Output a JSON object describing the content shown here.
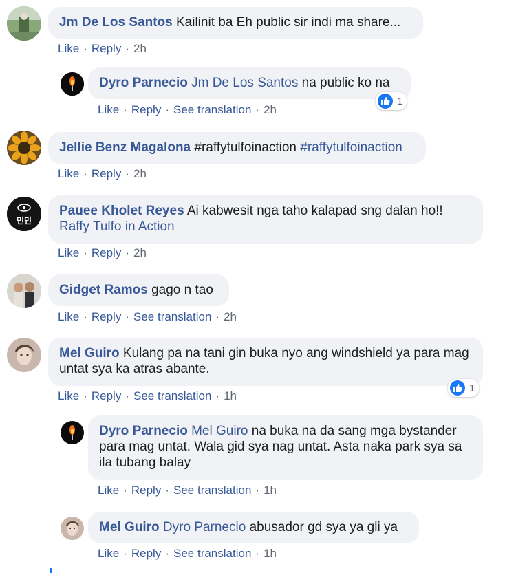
{
  "comments": [
    {
      "author": "Jm De Los Santos",
      "text": " Kailinit ba Eh public sir indi ma share...",
      "actions": {
        "like": "Like",
        "reply": "Reply",
        "time": "2h"
      }
    },
    {
      "author": "Dyro Parnecio",
      "mention": "Jm De Los Santos",
      "text": " na public ko na",
      "actions": {
        "like": "Like",
        "reply": "Reply",
        "translate": "See translation",
        "time": "2h"
      },
      "reaction_count": "1"
    },
    {
      "author": "Jellie Benz Magalona",
      "text": " #raffytulfoinaction ",
      "hashtag": "#raffytulfoinaction",
      "actions": {
        "like": "Like",
        "reply": "Reply",
        "time": "2h"
      }
    },
    {
      "author": "Pauee Kholet Reyes",
      "text": " Ai kabwesit nga taho kalapad sng dalan ho!!",
      "mention": "Raffy Tulfo in Action",
      "avatar_text": "민민",
      "actions": {
        "like": "Like",
        "reply": "Reply",
        "time": "2h"
      }
    },
    {
      "author": "Gidget Ramos",
      "text": " gago n tao",
      "actions": {
        "like": "Like",
        "reply": "Reply",
        "translate": "See translation",
        "time": "2h"
      }
    },
    {
      "author": "Mel Guiro",
      "text": " Kulang pa na tani gin buka nyo ang windshield ya para mag untat sya ka atras abante.",
      "actions": {
        "like": "Like",
        "reply": "Reply",
        "translate": "See translation",
        "time": "1h"
      },
      "reaction_count": "1"
    },
    {
      "author": "Dyro Parnecio",
      "mention": "Mel Guiro",
      "text": " na buka na da sang mga bystander para mag untat. Wala gid sya nag untat. Asta naka park sya sa ila tubang balay",
      "actions": {
        "like": "Like",
        "reply": "Reply",
        "translate": "See translation",
        "time": "1h"
      }
    },
    {
      "author": "Mel Guiro",
      "mention": "Dyro Parnecio",
      "text": " abusador gd sya ya gli ya",
      "actions": {
        "like": "Like",
        "reply": "Reply",
        "translate": "See translation",
        "time": "1h"
      }
    }
  ],
  "separator": "·",
  "colors": {
    "link": "#385898",
    "bubble": "#f0f2f5",
    "like_blue": "#1877f2",
    "meta": "#606770"
  }
}
